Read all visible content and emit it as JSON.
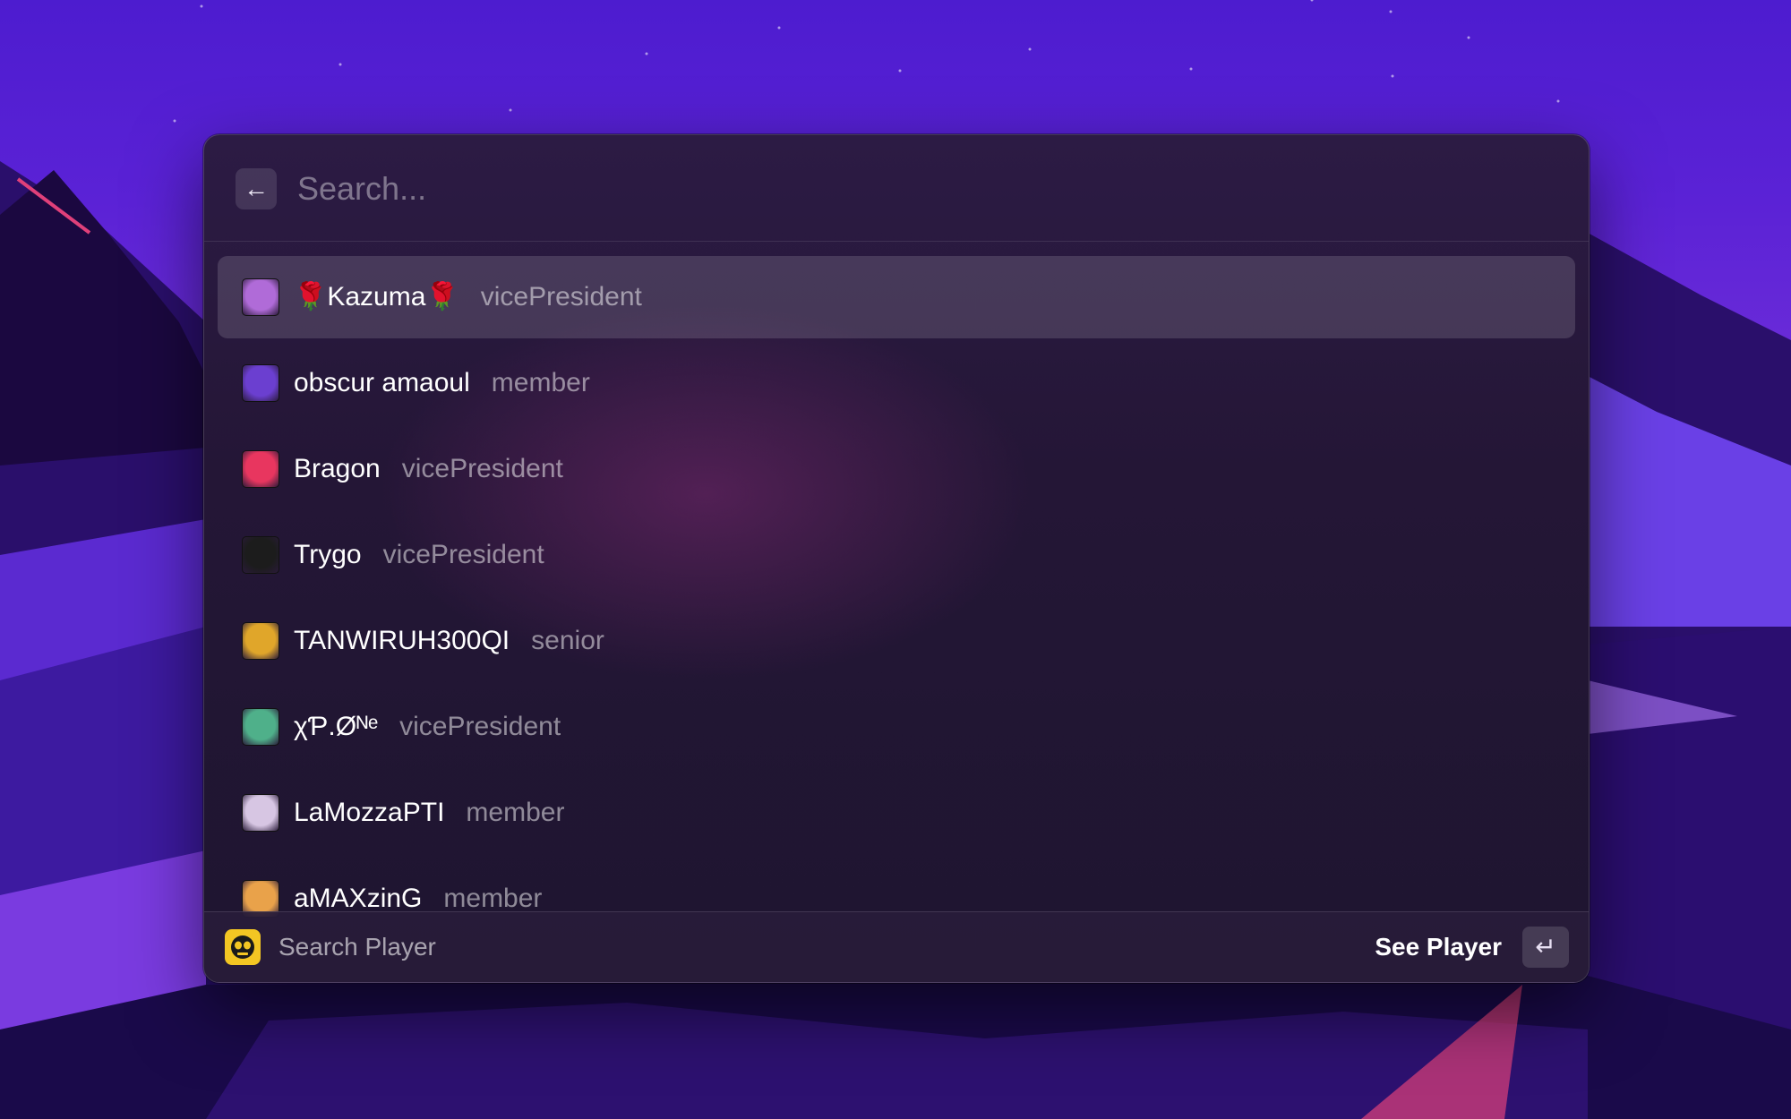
{
  "search": {
    "placeholder": "Search...",
    "back_icon": "←"
  },
  "members": [
    {
      "name": "🌹Kazuma🌹",
      "role": "vicePresident",
      "avatar_icon": "brawler-avatar",
      "avatar_color": "#b06bd8",
      "selected": true
    },
    {
      "name": "obscur amaoul",
      "role": "member",
      "avatar_icon": "brawler-avatar",
      "avatar_color": "#6b3fd0",
      "selected": false
    },
    {
      "name": "Bragon",
      "role": "vicePresident",
      "avatar_icon": "skull-avatar",
      "avatar_color": "#e8365f",
      "selected": false
    },
    {
      "name": "Trygo",
      "role": "vicePresident",
      "avatar_icon": "butterfly-avatar",
      "avatar_color": "#1c1c1c",
      "selected": false
    },
    {
      "name": "TANWIRUH300QI",
      "role": "senior",
      "avatar_icon": "badge-avatar",
      "avatar_color": "#e0a62a",
      "selected": false
    },
    {
      "name": "χƤ.Øᴺᵉ",
      "role": "vicePresident",
      "avatar_icon": "brawler-avatar",
      "avatar_color": "#4fb08a",
      "selected": false
    },
    {
      "name": "LaMozzaPTI",
      "role": "member",
      "avatar_icon": "brawler-avatar",
      "avatar_color": "#d7c6e3",
      "selected": false
    },
    {
      "name": "aMAXzinG",
      "role": "member",
      "avatar_icon": "brawler-avatar",
      "avatar_color": "#e9a24a",
      "selected": false
    }
  ],
  "footer": {
    "title": "Search Player",
    "app_icon": "brawl-stars-skull-icon",
    "action_label": "See Player",
    "action_key": "↵"
  },
  "colors": {
    "accent": "#f3c623",
    "selection": "#4a3560"
  }
}
